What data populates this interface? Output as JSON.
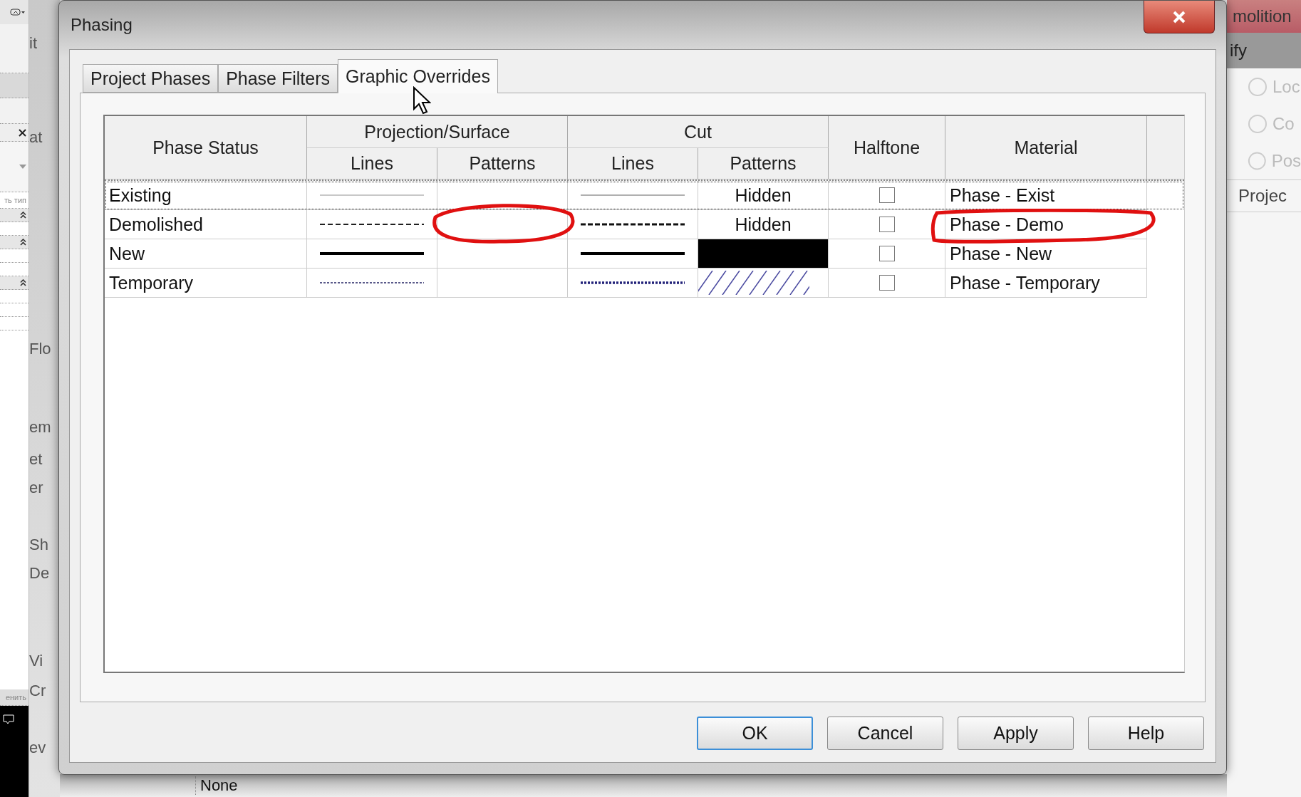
{
  "app_left": {
    "type_label": "ть тип",
    "apply_label": "енить"
  },
  "app_middle": {
    "fragments": [
      "it",
      "at",
      "Flo",
      "em",
      "et",
      "er",
      "Sh",
      "De",
      "Vi",
      "Cr",
      "ev"
    ]
  },
  "app_bottom": {
    "value": "None"
  },
  "app_right": {
    "title": "molition",
    "tab": "ify",
    "items": [
      "Loc",
      "Co",
      "Pos"
    ],
    "section": "Projec"
  },
  "dialog": {
    "title": "Phasing",
    "tabs": [
      {
        "label": "Project Phases",
        "selected": false
      },
      {
        "label": "Phase Filters",
        "selected": false
      },
      {
        "label": "Graphic Overrides",
        "selected": true
      }
    ],
    "table": {
      "columns": {
        "status": "Phase Status",
        "projection": "Projection/Surface",
        "cut": "Cut",
        "proj_lines": "Lines",
        "proj_patterns": "Patterns",
        "cut_lines": "Lines",
        "cut_patterns": "Patterns",
        "halftone": "Halftone",
        "material": "Material"
      },
      "rows": [
        {
          "status": "Existing",
          "selected": true,
          "proj_lines": {
            "kind": "solid",
            "color": "#c8c8c8"
          },
          "proj_patterns": {
            "kind": "none"
          },
          "cut_lines": {
            "kind": "solid",
            "color": "#b0b0b0"
          },
          "cut_patterns": {
            "kind": "text",
            "text": "Hidden"
          },
          "halftone": false,
          "material": "Phase - Exist"
        },
        {
          "status": "Demolished",
          "selected": false,
          "proj_lines": {
            "kind": "dashed",
            "color": "#202020"
          },
          "proj_patterns": {
            "kind": "none"
          },
          "cut_lines": {
            "kind": "bold-dashed",
            "color": "#101010"
          },
          "cut_patterns": {
            "kind": "text",
            "text": "Hidden"
          },
          "halftone": false,
          "material": "Phase - Demo"
        },
        {
          "status": "New",
          "selected": false,
          "proj_lines": {
            "kind": "thick",
            "color": "#000000"
          },
          "proj_patterns": {
            "kind": "none"
          },
          "cut_lines": {
            "kind": "thick",
            "color": "#000000"
          },
          "cut_patterns": {
            "kind": "solid"
          },
          "halftone": false,
          "material": "Phase - New"
        },
        {
          "status": "Temporary",
          "selected": false,
          "proj_lines": {
            "kind": "dotted",
            "color": "#5a5a8a"
          },
          "proj_patterns": {
            "kind": "none"
          },
          "cut_lines": {
            "kind": "bold-dotted",
            "color": "#23237a"
          },
          "cut_patterns": {
            "kind": "hatch"
          },
          "halftone": false,
          "material": "Phase - Temporary"
        }
      ]
    },
    "buttons": [
      {
        "label": "OK",
        "default": true
      },
      {
        "label": "Cancel",
        "default": false
      },
      {
        "label": "Apply",
        "default": false
      },
      {
        "label": "Help",
        "default": false
      }
    ]
  }
}
